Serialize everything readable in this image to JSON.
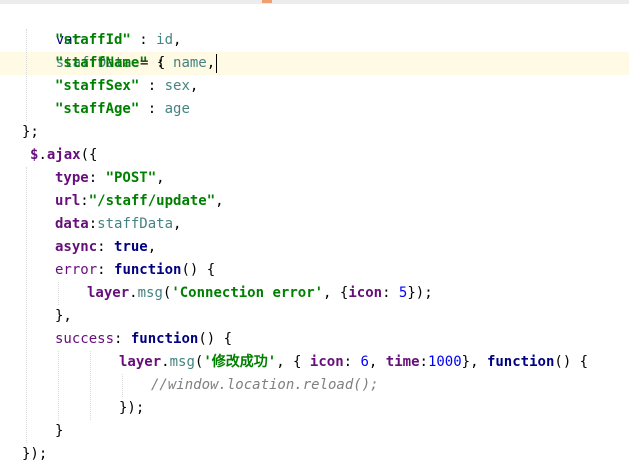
{
  "code": {
    "l1": {
      "kw": "var",
      "name": "staffData",
      "eq": " = {"
    },
    "l2": {
      "key": "\"staffId\"",
      "colon": " : ",
      "val": "id",
      "end": ","
    },
    "l3": {
      "key": "\"staffName\"",
      "colon": " : ",
      "val": "name",
      "end": ","
    },
    "l4": {
      "key": "\"staffSex\"",
      "colon": " : ",
      "val": "sex",
      "end": ","
    },
    "l5": {
      "key": "\"staffAge\"",
      "colon": " : ",
      "val": "age"
    },
    "l6": "};",
    "l7": {
      "jq": "$",
      "dot": ".",
      "fn": "ajax",
      "open": "({"
    },
    "l8": {
      "key": "type",
      "colon": ": ",
      "val": "\"POST\"",
      "end": ","
    },
    "l9": {
      "key": "url",
      "colon": ":",
      "val": "\"/staff/update\"",
      "end": ","
    },
    "l10": {
      "key": "data",
      "colon": ":",
      "val": "staffData",
      "end": ","
    },
    "l11": {
      "key": "async",
      "colon": ": ",
      "val": "true",
      "end": ","
    },
    "l12": {
      "key": "error",
      "colon": ": ",
      "fn": "function",
      "end": "() {"
    },
    "l13": {
      "obj": "layer",
      "dot": ".",
      "method": "msg",
      "p1": "(",
      "str": "'Connection error'",
      "p2": ", {",
      "key": "icon",
      "colon": ": ",
      "num": "5",
      "p3": "});"
    },
    "l14": "},",
    "l15": {
      "key": "success",
      "colon": ": ",
      "fn": "function",
      "end": "() {"
    },
    "l16": {
      "obj": "layer",
      "dot": ".",
      "method": "msg",
      "p1": "(",
      "str": "'修改成功'",
      "p2": ", { ",
      "key1": "icon",
      "colon1": ": ",
      "num1": "6",
      "p3": ", ",
      "key2": "time",
      "colon2": ":",
      "num2": "1000",
      "p4": "}, ",
      "fn": "function",
      "p5": "() {"
    },
    "l17": "//window.location.reload();",
    "l18": "});",
    "l19": "}",
    "l20": "});"
  },
  "colors": {
    "keyword": "#000080",
    "property": "#660e7a",
    "string": "#008000",
    "number": "#0000ff",
    "identifier": "#458383",
    "comment": "#808080",
    "current_line": "#fffae3"
  }
}
